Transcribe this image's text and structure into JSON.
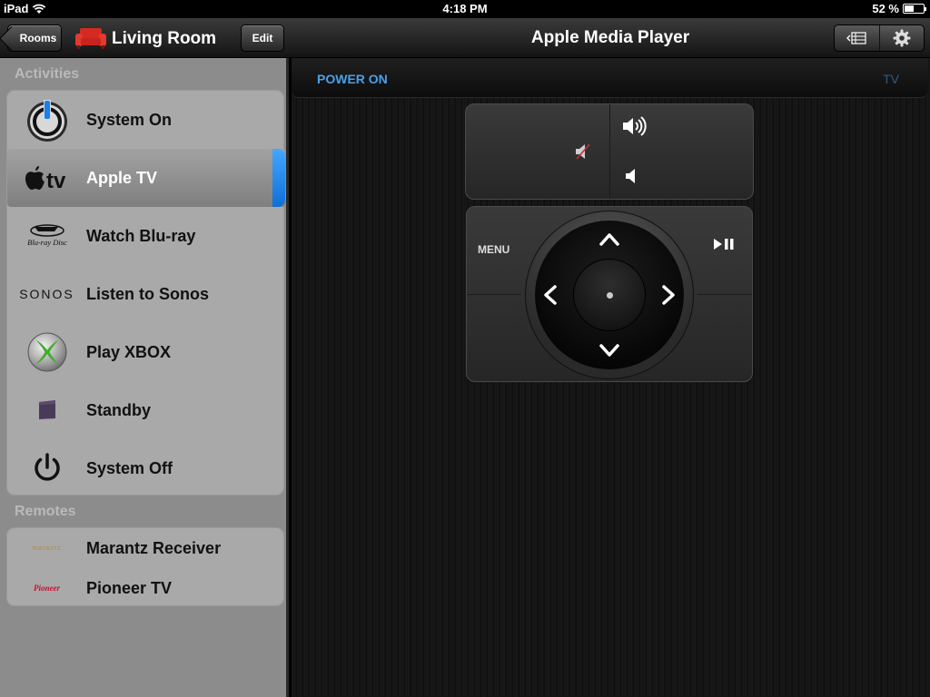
{
  "status_bar": {
    "device": "iPad",
    "time": "4:18 PM",
    "battery": "52 %",
    "battery_level": 0.52
  },
  "nav": {
    "rooms_label": "Rooms",
    "room_title": "Living Room",
    "edit_label": "Edit",
    "page_title": "Apple Media Player"
  },
  "sidebar": {
    "activities_header": "Activities",
    "activities": [
      {
        "label": "System On",
        "icon": "power-on-icon"
      },
      {
        "label": "Apple TV",
        "icon": "apple-tv-icon",
        "selected": true
      },
      {
        "label": "Watch Blu-ray",
        "icon": "bluray-icon"
      },
      {
        "label": "Listen to Sonos",
        "icon": "sonos-icon"
      },
      {
        "label": "Play XBOX",
        "icon": "xbox-icon"
      },
      {
        "label": "Standby",
        "icon": "standby-icon"
      },
      {
        "label": "System Off",
        "icon": "power-off-icon"
      }
    ],
    "remotes_header": "Remotes",
    "remotes": [
      {
        "label": "Marantz Receiver",
        "icon": "marantz-logo-icon"
      },
      {
        "label": "Pioneer TV",
        "icon": "pioneer-logo-icon"
      }
    ],
    "logo_text": {
      "apple_tv": "tv",
      "bluray": "Blu-ray Disc",
      "sonos": "SONOS",
      "pioneer": "Pioneer",
      "marantz": "marantz"
    }
  },
  "main": {
    "power_on_label": "POWER ON",
    "device_label": "TV",
    "menu_label": "MENU"
  },
  "colors": {
    "accent_blue": "#4aa0e8",
    "selection_blue": "#1f86f0",
    "sidebar_bg": "#8c8c8c",
    "row_bg": "#a9a9a9"
  }
}
